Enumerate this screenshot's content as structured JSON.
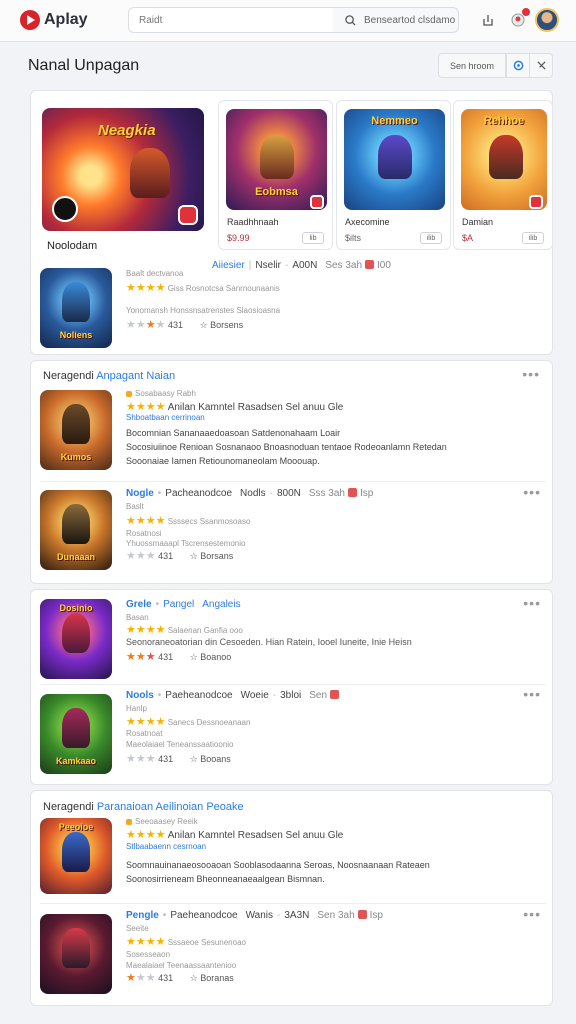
{
  "header": {
    "logo_text": "Aplay",
    "search_placeholder": "Raidt",
    "search_button": "Benseartod clsdamo"
  },
  "page": {
    "title": "Nanal Unpagan",
    "sort_label": "Sen hroom"
  },
  "featured": {
    "main": {
      "art_title": "Neagkia",
      "name": "Noolodam"
    },
    "tiles": [
      {
        "art_title": "Eobmsa",
        "name": "Raadhhnaah",
        "price": "$9.99",
        "btn": "lib"
      },
      {
        "art_title": "Nemmeo",
        "name": "Axecomine",
        "price": "$ilts",
        "btn": "ilib"
      },
      {
        "art_title": "Rehhoe",
        "name": "Damian",
        "price": "$A",
        "btn": "ilib"
      }
    ],
    "list_item": {
      "icon_title": "Noliens",
      "title_a": "Aiiesier",
      "title_b": "Nselir",
      "title_c": "A00N",
      "title_d": "Ses  3ah",
      "title_e": "I00",
      "line1": "Baalt dectvanoa",
      "line2": "Giss  Rosnotcsa  Sanrnounaanis",
      "line3": "Yonomansh  Honssnsatrenstes  Slaosioasna",
      "count": "431",
      "tag": "Borsens"
    }
  },
  "section1": {
    "head": "Neragendi",
    "head_accent": "Anpagant Naian",
    "items": [
      {
        "icon_title": "Kumos",
        "line1": "Sosabaasy  Rabh",
        "title": "Anilan  Kamntel  Rasadsen Sel anuu  Gle",
        "sub": "Shboatbaan  cerrinoan",
        "desc1": "Bocomnian Sananaaedoasoan  Satdenonahaam  Loair",
        "desc2": "Socosiuiinoe Renioan  Sosnanaoo  Bnoasnoduan tentaoe  Rodeoanlamn Retedan",
        "desc3": "Sooonaiae Iamen  Retiounomaneolam  Mooouap."
      },
      {
        "icon_title": "Dunaaan",
        "title_a": "Nogle",
        "title_b": "Pacheanodcoe",
        "title_c": "Nodls",
        "title_d": "800N",
        "title_e": "Sss  3ah",
        "title_f": "Isp",
        "line1": "Baslt",
        "line2": "Ssssecs  Ssanmosoaso",
        "line3": "Rosatnosi",
        "line4": "Yhuossmaaapl  Tscrensestemonio",
        "count": "431",
        "tag": "Borsans"
      }
    ]
  },
  "section2": {
    "items": [
      {
        "icon_title": "Dosinio",
        "title_a": "Grele",
        "title_b": "Pangel",
        "title_c": "Angaleis",
        "line1": "Basan",
        "line2": "Salaenan  Ganfia ooo",
        "line3": "Seonoraneoatorian din Cesoeden.  Hian Ratein, Iooel Iuneite, Inie Heisn",
        "count": "431",
        "tag": "Boanoo"
      },
      {
        "icon_title": "Kamkaao",
        "title_a": "Nools",
        "title_b": "Paeheanodcoe",
        "title_c": "Woeie",
        "title_d": "3bloi",
        "title_e": "Sen",
        "line1": "Hanlp",
        "line2": "Sanecs  Dessnoeanaan",
        "line3": "Rosatnoat",
        "line4": "Maeolaiael  Teneanssaatioonio",
        "count": "431",
        "tag": "Booans"
      }
    ]
  },
  "section3": {
    "head": "Neragendi",
    "head_accent": "Paranaioan Aeilinoian",
    "head_tail": "Peoake",
    "items": [
      {
        "icon_title": "Peeoioe",
        "line1": "Seeoaasey  Reeik",
        "title": "Anilan  Kamntel  Resadsen Sel anuu  Gle",
        "sub": "Stlbaabaenn  cesrnoan",
        "desc1": "Soomnauinanaeosooaoan  Sooblasodaanna  Seroas,  Noosnaanaan Rateaen",
        "desc2": "Soonosirrieneam  Bheonneanaeaalgean  Bismnan."
      },
      {
        "icon_title": "",
        "title_a": "Pengle",
        "title_b": "Paeheanodcoe",
        "title_c": "Wanis",
        "title_d": "3A3N",
        "title_e": "Sen  3ah",
        "title_f": "Isp",
        "line1": "Seeite",
        "line2": "Sssaeoe  Sesunenoao",
        "line3": "Sosesseaon",
        "line4": "Maealaiael  Teenaassaantenioo",
        "count": "431",
        "tag": "Boranas"
      }
    ]
  },
  "colors": {
    "accent": "#2c7be5",
    "brand": "#d9222a",
    "star": "#f5b300",
    "price": "#b6303a"
  },
  "icons": [
    "play-logo-icon",
    "search-icon",
    "share-icon",
    "notification-icon",
    "refresh-icon",
    "expand-icon",
    "star-icon",
    "more-icon",
    "bookmark-icon",
    "badge-icon"
  ]
}
